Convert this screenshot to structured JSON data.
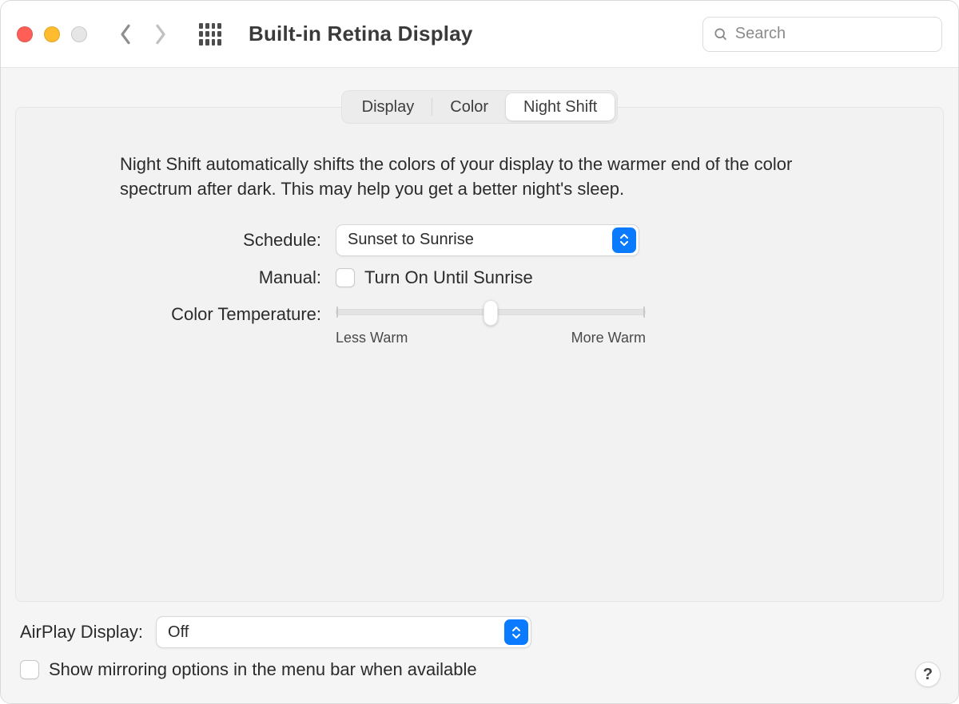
{
  "header": {
    "title": "Built-in Retina Display",
    "search_placeholder": "Search"
  },
  "tabs": {
    "items": [
      "Display",
      "Color",
      "Night Shift"
    ],
    "active_index": 2
  },
  "nightshift": {
    "description": "Night Shift automatically shifts the colors of your display to the warmer end of the color spectrum after dark. This may help you get a better night's sleep.",
    "schedule_label": "Schedule:",
    "schedule_value": "Sunset to Sunrise",
    "manual_label": "Manual:",
    "manual_checkbox_label": "Turn On Until Sunrise",
    "manual_checked": false,
    "color_temp_label": "Color Temperature:",
    "slider": {
      "min_label": "Less Warm",
      "max_label": "More Warm",
      "value_percent": 50
    }
  },
  "airplay": {
    "label": "AirPlay Display:",
    "value": "Off"
  },
  "mirroring": {
    "label": "Show mirroring options in the menu bar when available",
    "checked": false
  },
  "help_symbol": "?"
}
